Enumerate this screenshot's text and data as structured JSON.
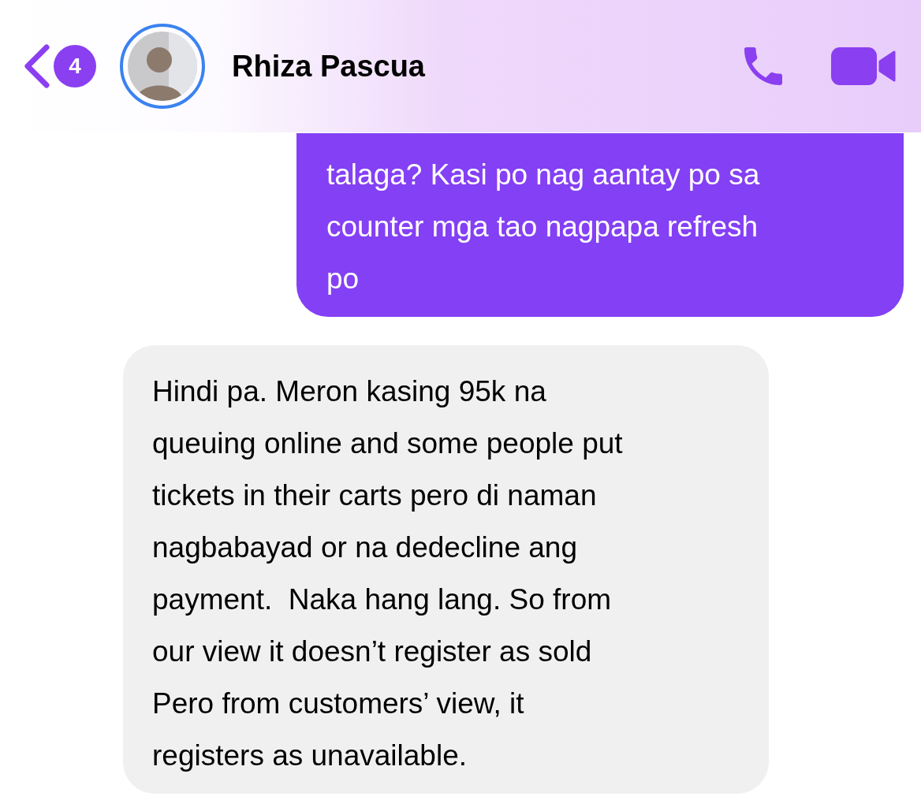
{
  "header": {
    "unread_count": "4",
    "contact_name": "Rhiza Pascua"
  },
  "messages": [
    {
      "kind": "sent",
      "text": "talaga? Kasi po nag aantay po sa\ncounter mga tao nagpapa refresh\npo"
    },
    {
      "kind": "received",
      "text": "Hindi pa. Meron kasing 95k na\nqueuing online and some people put\ntickets in their carts pero di naman\nnagbabayad or na dedecline ang\npayment.  Naka hang lang. So from\nour view it doesn’t register as sold\nPero from customers’ view, it\nregisters as unavailable."
    }
  ]
}
